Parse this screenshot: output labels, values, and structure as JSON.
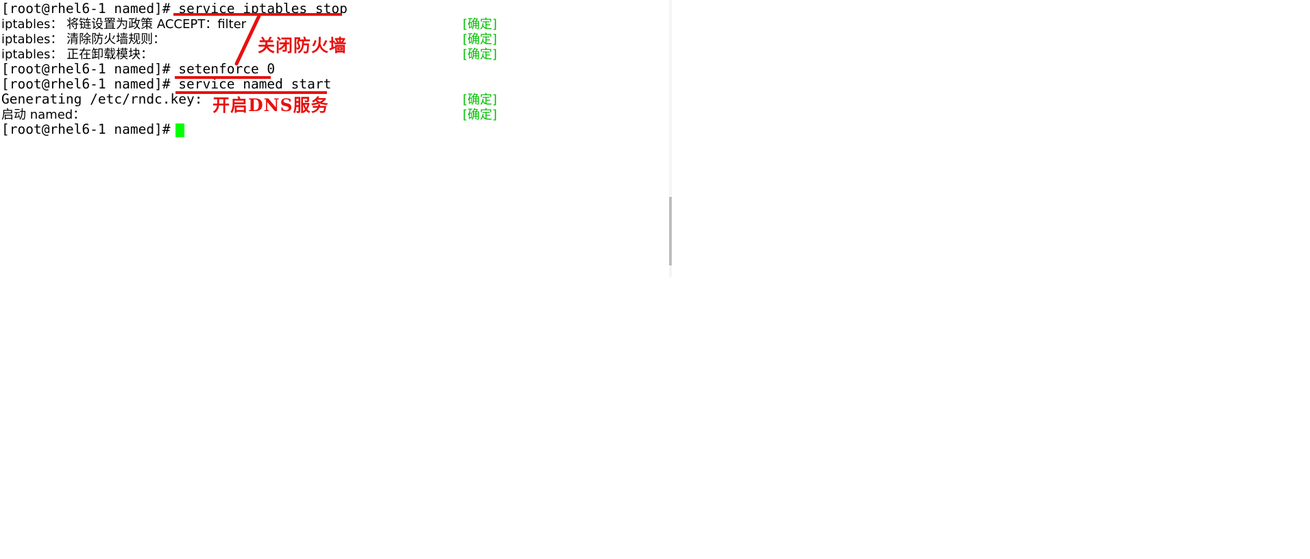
{
  "terminal": {
    "prompt": "[root@rhel6-1 named]# ",
    "cursor_color": "#00ff00",
    "status_ok_color": "#00c000",
    "lines": [
      {
        "id": "line-1",
        "kind": "command",
        "prompt": "[root@rhel6-1 named]# ",
        "command": "service iptables stop",
        "text": "[root@rhel6-1 named]# service iptables stop",
        "status": ""
      },
      {
        "id": "line-2",
        "kind": "output",
        "label": "iptables：",
        "message": "将链设置为政策 ACCEPT：filter",
        "text": "iptables： 将链设置为政策 ACCEPT：filter",
        "status": "[确定]"
      },
      {
        "id": "line-3",
        "kind": "output",
        "label": "iptables：",
        "message": "清除防火墙规则：",
        "text": "iptables： 清除防火墙规则：",
        "status": "[确定]"
      },
      {
        "id": "line-4",
        "kind": "output",
        "label": "iptables：",
        "message": "正在卸载模块：",
        "text": "iptables： 正在卸载模块：",
        "status": "[确定]"
      },
      {
        "id": "line-5",
        "kind": "command",
        "prompt": "[root@rhel6-1 named]# ",
        "command": "setenforce 0",
        "text": "[root@rhel6-1 named]# setenforce 0",
        "status": ""
      },
      {
        "id": "line-6",
        "kind": "command",
        "prompt": "[root@rhel6-1 named]# ",
        "command": "service named start",
        "text": "[root@rhel6-1 named]# service named start",
        "status": ""
      },
      {
        "id": "line-7",
        "kind": "output",
        "label": "",
        "message": "Generating /etc/rndc.key:",
        "text": "Generating /etc/rndc.key:",
        "status": "[确定]"
      },
      {
        "id": "line-8",
        "kind": "output",
        "label": "",
        "message": "启动 named：",
        "text": "启动 named：",
        "status": "[确定]"
      },
      {
        "id": "line-9",
        "kind": "command",
        "prompt": "[root@rhel6-1 named]# ",
        "command": "",
        "text": "[root@rhel6-1 named]# ",
        "status": ""
      }
    ]
  },
  "annotations": {
    "color": "#e8100f",
    "labels": [
      {
        "id": "ann-firewall",
        "text": "关闭防火墙"
      },
      {
        "id": "ann-dns",
        "text": "开启DNS服务"
      }
    ],
    "underlines": [
      {
        "id": "underline-service-iptables-stop",
        "target": "service iptables stop"
      },
      {
        "id": "underline-setenforce-0",
        "target": "setenforce 0"
      },
      {
        "id": "underline-service-named-start",
        "target": "service named start"
      }
    ],
    "arrows": [
      {
        "id": "arrow-firewall",
        "points_to": "service iptables stop"
      }
    ]
  },
  "scrollbar": {
    "orientation": "vertical",
    "track_color": "#f5f5f5",
    "thumb_color": "#bdbdbd"
  }
}
